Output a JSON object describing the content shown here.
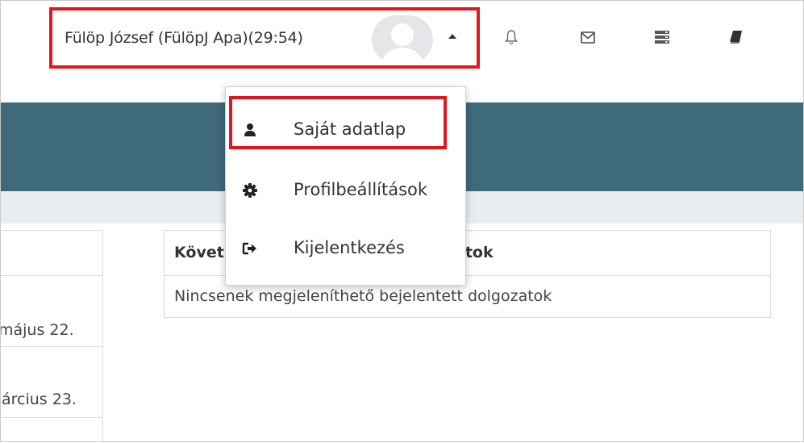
{
  "header": {
    "user_name": "Fülöp József (FülöpJ Apa)(29:54)",
    "avatar_icon": "avatar-placeholder-icon",
    "caret_icon": "caret-up-icon",
    "icons": [
      "bell-icon",
      "envelope-icon",
      "server-icon",
      "book-icon"
    ]
  },
  "dropdown": {
    "items": [
      {
        "label": "Saját adatlap",
        "icon": "user-icon"
      },
      {
        "label": "Profilbeállítások",
        "icon": "gear-icon"
      },
      {
        "label": "Kijelentkezés",
        "icon": "sign-out-icon"
      }
    ]
  },
  "left_panel": {
    "dates": [
      "május 22.",
      "árcius 23."
    ]
  },
  "table": {
    "header_start": "Követ",
    "header_end": "atok",
    "empty_message": "Nincsenek megjeleníthető bejelentett dolgozatok"
  },
  "colors": {
    "highlight": "#e3161e",
    "banner": "#3f6a7a",
    "subbar": "#e9edf0"
  }
}
